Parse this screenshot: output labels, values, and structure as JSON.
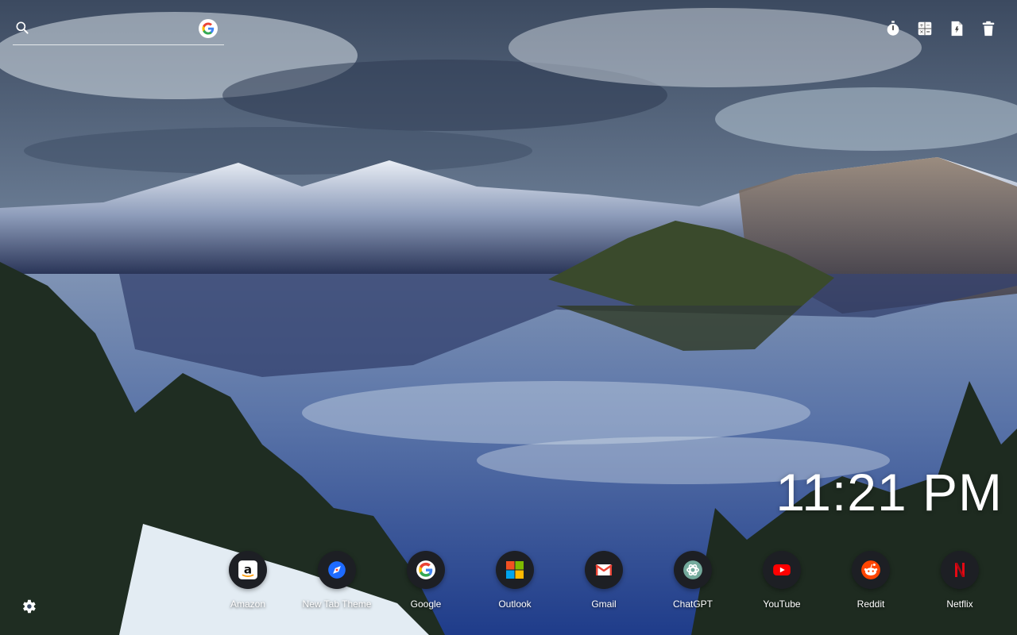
{
  "search": {
    "placeholder": "",
    "engine_icon": "google-g-icon"
  },
  "toolbar": {
    "icons": [
      "timer-icon",
      "calculator-icon",
      "document-icon",
      "trash-icon"
    ]
  },
  "clock": {
    "time": "11:21 PM"
  },
  "quick_links": [
    {
      "label": "Amazon",
      "icon": "amazon-icon",
      "color": "#ffffff"
    },
    {
      "label": "New Tab Theme",
      "icon": "compass-icon",
      "color": "#1e6bff"
    },
    {
      "label": "Google",
      "icon": "google-g-icon",
      "color": "#ffffff"
    },
    {
      "label": "Outlook",
      "icon": "windows-grid-icon",
      "color": "#f25022"
    },
    {
      "label": "Gmail",
      "icon": "gmail-icon",
      "color": "#ea4335"
    },
    {
      "label": "ChatGPT",
      "icon": "chatgpt-icon",
      "color": "#74aa9c"
    },
    {
      "label": "YouTube",
      "icon": "youtube-icon",
      "color": "#ff0000"
    },
    {
      "label": "Reddit",
      "icon": "reddit-icon",
      "color": "#ff4500"
    },
    {
      "label": "Netflix",
      "icon": "netflix-icon",
      "color": "#e50914"
    }
  ],
  "settings": {
    "icon": "gear-icon"
  }
}
